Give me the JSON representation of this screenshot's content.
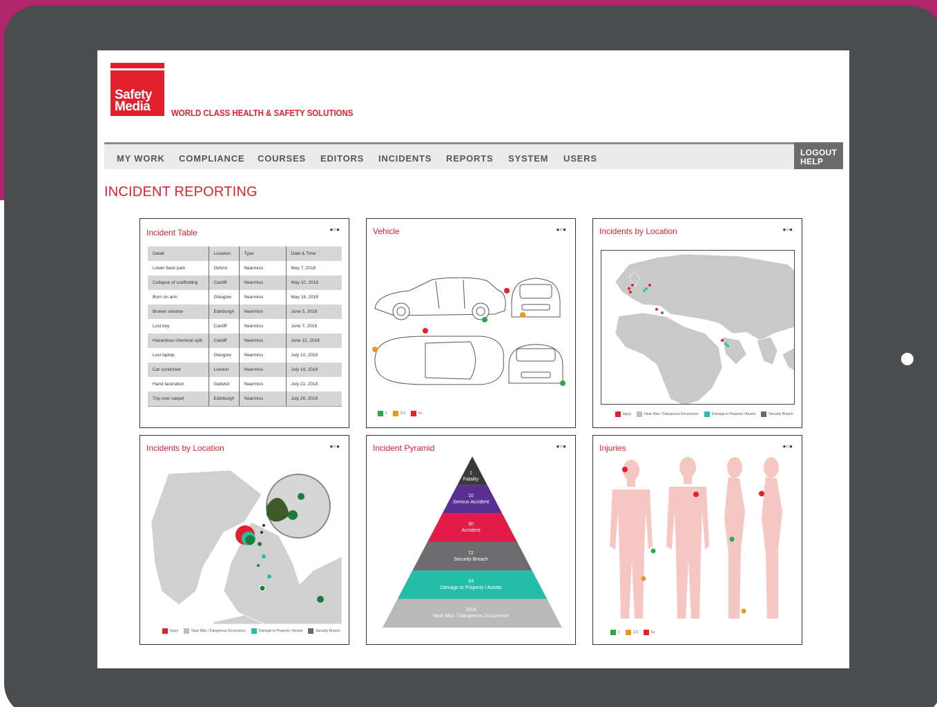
{
  "brand": {
    "logo_line1": "Safety",
    "logo_line2": "Media",
    "tagline": "WORLD CLASS HEALTH & SAFETY SOLUTIONS",
    "red": "#e3202e",
    "magenta": "#b0256c"
  },
  "nav": {
    "items": [
      {
        "label": "MY WORK"
      },
      {
        "label": "COMPLIANCE"
      },
      {
        "label": "COURSES"
      },
      {
        "label": "EDITORS"
      },
      {
        "label": "INCIDENTS"
      },
      {
        "label": "REPORTS"
      },
      {
        "label": "SYSTEM"
      },
      {
        "label": "USERS"
      }
    ],
    "logout": "LOGOUT",
    "help": "HELP"
  },
  "page_title": "INCIDENT REPORTING",
  "panels": {
    "incident_table": {
      "title": "Incident Table",
      "menu": "●○●",
      "columns": [
        "Detail",
        "Location",
        "Type",
        "Date & Time"
      ],
      "rows": [
        [
          "Lower back pain",
          "Oxford",
          "Nearmiss",
          "May 7, 2018"
        ],
        [
          "Collapse of scaffolding",
          "Cardiff",
          "Nearmiss",
          "May 10, 2018"
        ],
        [
          "Burn on arm",
          "Glasgow",
          "Nearmiss",
          "May 18, 2018"
        ],
        [
          "Broken window",
          "Edinburgh",
          "Nearmiss",
          "June 5, 2018"
        ],
        [
          "Lost key",
          "Cardiff",
          "Nearmiss",
          "June 7, 2018"
        ],
        [
          "Hazardous chemical spill",
          "Cardiff",
          "Nearmiss",
          "June 12, 2018"
        ],
        [
          "Lost laptop",
          "Glasgow",
          "Nearmiss",
          "July 10, 2018"
        ],
        [
          "Car scratched",
          "London",
          "Nearmiss",
          "July 19, 2018"
        ],
        [
          "Hand laceration",
          "Gatwick",
          "Nearmiss",
          "July 21, 2018"
        ],
        [
          "Trip over carpet",
          "Edinburgh",
          "Nearmiss",
          "July 26, 2018"
        ]
      ]
    },
    "vehicle": {
      "title": "Vehicle",
      "menu": "●○●",
      "legend": [
        {
          "label": "1",
          "color": "#2aa84a"
        },
        {
          "label": "2-5",
          "color": "#f0951e"
        },
        {
          "label": "6+",
          "color": "#e3202e"
        }
      ]
    },
    "world_map": {
      "title": "Incidents by Location",
      "menu": "●○●",
      "legend": [
        {
          "label": "Injury",
          "color": "#e3202e"
        },
        {
          "label": "Near Miss / Dangerous Occurrence",
          "color": "#bdbdbd"
        },
        {
          "label": "Damage to Property / Assets",
          "color": "#26bfa7"
        },
        {
          "label": "Security Breach",
          "color": "#6b6b6d"
        }
      ]
    },
    "uk_map": {
      "title": "Incidents by Location",
      "menu": "●○●",
      "legend": [
        {
          "label": "Injury",
          "color": "#e3202e"
        },
        {
          "label": "Near Miss / Dangerous Occurrence",
          "color": "#bdbdbd"
        },
        {
          "label": "Damage to Property / Assets",
          "color": "#26bfa7"
        },
        {
          "label": "Security Breach",
          "color": "#6b6b6d"
        }
      ]
    },
    "pyramid": {
      "title": "Incident Pyramid",
      "menu": "●○●",
      "layers": [
        {
          "count": "1",
          "label": "Fatality",
          "color": "#3a3a3a"
        },
        {
          "count": "10",
          "label": "Serious Accident",
          "color": "#5b2e91"
        },
        {
          "count": "30",
          "label": "Accident",
          "color": "#e31c47"
        },
        {
          "count": "72",
          "label": "Security Breach",
          "color": "#6d6d6f"
        },
        {
          "count": "93",
          "label": "Damage to Property / Assets",
          "color": "#24bea8"
        },
        {
          "count": "3104",
          "label": "Near Miss / Dangerous Occurrence",
          "color": "#b9b9b9"
        }
      ]
    },
    "injuries": {
      "title": "Injuries",
      "menu": "●○●",
      "legend": [
        {
          "label": "1",
          "color": "#2aa84a"
        },
        {
          "label": "2-5",
          "color": "#f0951e"
        },
        {
          "label": "6+",
          "color": "#e3202e"
        }
      ]
    }
  }
}
